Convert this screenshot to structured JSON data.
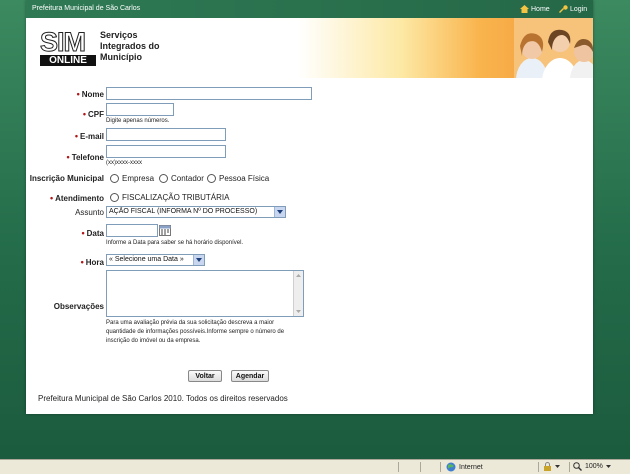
{
  "topbar": {
    "org_name": "Prefeitura Municipal de São Carlos",
    "home_label": "Home",
    "login_label": "Login"
  },
  "logo": {
    "sim": "SIM",
    "online": "ONLINE",
    "line1": "Serviços",
    "line2": "Integrados do",
    "line3": "Município"
  },
  "form": {
    "nome_label": "Nome",
    "cpf_label": "CPF",
    "cpf_hint": "Digite apenas números.",
    "email_label": "E-mail",
    "telefone_label": "Telefone",
    "telefone_hint": "(xx)xxxx-xxxx",
    "inscricao_label": "Inscrição Municipal",
    "inscricao_options": [
      "Empresa",
      "Contador",
      "Pessoa Física"
    ],
    "atendimento_label": "Atendimento",
    "atendimento_option": "FISCALIZAÇÃO TRIBUTÁRIA",
    "assunto_label": "Assunto",
    "assunto_value": "AÇÃO FISCAL (INFORMA Nº DO PROCESSO)",
    "data_label": "Data",
    "data_hint": "Informe a Data para saber se há horário disponível.",
    "hora_label": "Hora",
    "hora_value": "« Selecione uma Data »",
    "obs_label": "Observações",
    "obs_hint_1": "Para uma avaliação prévia da sua solicitação descreva a maior",
    "obs_hint_2": "quantidade de informações possíveis.Informe sempre o número de",
    "obs_hint_3": "inscrição do imóvel ou da empresa.",
    "voltar_label": "Voltar",
    "agendar_label": "Agendar"
  },
  "footer": {
    "copyright": "Prefeitura Municipal de São Carlos 2010. Todos os direitos reservados"
  },
  "statusbar": {
    "zone": "Internet",
    "zoom": "100%"
  },
  "colors": {
    "header_green": "#2f7a55",
    "required_red": "#b01818",
    "background_green": "#236b49"
  }
}
